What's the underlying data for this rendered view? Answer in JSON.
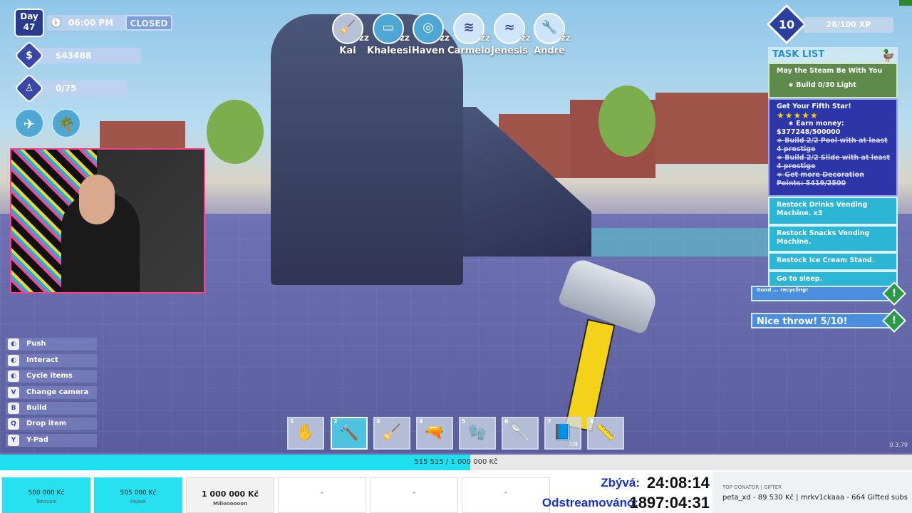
{
  "hud": {
    "day_label": "Day",
    "day_number": "47",
    "time": "06:00 PM",
    "status": "CLOSED",
    "money": "$43488",
    "guests": "0/75"
  },
  "staff": [
    {
      "name": "Kai",
      "zz": "zz",
      "icon": "mop-icon"
    },
    {
      "name": "Khaleesi",
      "zz": "zz",
      "icon": "register-icon"
    },
    {
      "name": "Haven",
      "zz": "zz",
      "icon": "lifebuoy-icon"
    },
    {
      "name": "Carmelo",
      "zz": "zz",
      "icon": "mop-icon"
    },
    {
      "name": "Jenesis",
      "zz": "zz",
      "icon": "pool-icon"
    },
    {
      "name": "Andre",
      "zz": "zz",
      "icon": "wrench-icon"
    }
  ],
  "level": {
    "value": "10",
    "xp": "28/100 XP"
  },
  "tasks": {
    "title": "TASK LIST",
    "t1_title": "May the Steam Be With You",
    "t1_sub": "Build 0/30 Light",
    "t2_title": "Get Your Fifth Star!",
    "t2_stars": "★★★★★",
    "t2_sub1": "Earn money:",
    "t2_sub1b": "$377248/500000",
    "t2_sub2": "Build 2/2 Pool with at least 4 prestige",
    "t2_sub3": "Build 2/2 Slide with at least 4 prestige",
    "t2_sub4": "Get more Decoration Points: 5419/2500",
    "t3": "Restock Drinks Vending Machine. x3",
    "t4": "Restock Snacks Vending Machine.",
    "t5": "Restock Ice Cream Stand.",
    "t6": "Go to sleep."
  },
  "notifications": {
    "n1": "Good ... recycling!",
    "n2": "Nice throw! 5/10!"
  },
  "controls": [
    {
      "key": "◐",
      "label": "Push"
    },
    {
      "key": "◐",
      "label": "Interact"
    },
    {
      "key": "◐",
      "label": "Cycle items"
    },
    {
      "key": "V",
      "label": "Change camera"
    },
    {
      "key": "B",
      "label": "Build"
    },
    {
      "key": "Q",
      "label": "Drop item"
    },
    {
      "key": "Y",
      "label": "Y-Pad"
    }
  ],
  "hotbar": [
    {
      "n": "1",
      "glyph": "✋",
      "qty": ""
    },
    {
      "n": "2",
      "glyph": "🔨",
      "qty": ""
    },
    {
      "n": "3",
      "glyph": "🧹",
      "qty": ""
    },
    {
      "n": "4",
      "glyph": "🔫",
      "qty": ""
    },
    {
      "n": "5",
      "glyph": "🧤",
      "qty": ""
    },
    {
      "n": "6",
      "glyph": "🥄",
      "qty": ""
    },
    {
      "n": "7",
      "glyph": "📘",
      "qty": "7/9"
    },
    {
      "n": "8",
      "glyph": "📏",
      "qty": ""
    }
  ],
  "version": "0.3.79",
  "stream": {
    "progress_label": "515 515 / 1 000 000 Kč",
    "progress_fraction": 0.515515,
    "goals": [
      {
        "amount": "500 000 Kč",
        "name": "Tetování"
      },
      {
        "amount": "505 000 Kč",
        "name": "Pejsek"
      },
      {
        "amount": "1 000 000 Kč",
        "name": "Milioooooon"
      },
      {
        "amount": "-",
        "name": ""
      },
      {
        "amount": "-",
        "name": ""
      },
      {
        "amount": "-",
        "name": ""
      }
    ],
    "remaining_label": "Zbývá:",
    "remaining_value": "24:08:14",
    "streamed_label": "Odstreamováno:",
    "streamed_value": "1897:04:31",
    "donor_header": "TOP DONATOR | GIFTER",
    "donor_text": "peta_xd - 89 530 Kč | mrkv1ckaaa - 664 Gifted subs"
  },
  "colors": {
    "accent": "#2c36a8",
    "cyan": "#26e2f0",
    "task_green": "#5e8a4c"
  }
}
